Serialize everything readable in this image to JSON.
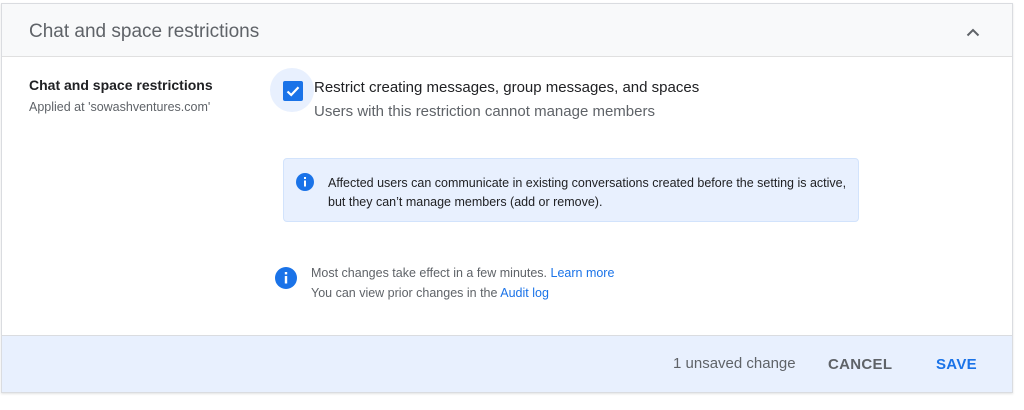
{
  "header": {
    "title": "Chat and space restrictions",
    "collapse_icon": "chevron-up-icon"
  },
  "setting": {
    "label": "Chat and space restrictions",
    "applied_at": "Applied at 'sowashventures.com'"
  },
  "option": {
    "checked": true,
    "label": "Restrict creating messages, group messages, and spaces",
    "description": "Users with this restriction cannot manage members"
  },
  "info_box": {
    "icon": "info-icon",
    "text": "Affected users can communicate in existing conversations created before the setting is active, but they can’t manage members (add or remove)."
  },
  "notes": {
    "icon": "info-icon",
    "line1_text": "Most changes take effect in a few minutes.",
    "line1_link": "Learn more",
    "line2_text": "You can view prior changes in the",
    "line2_link": "Audit log"
  },
  "footer": {
    "status": "1 unsaved change",
    "cancel_label": "CANCEL",
    "save_label": "SAVE"
  },
  "colors": {
    "accent": "#1a73e8",
    "info_bg": "#e8f0fe",
    "header_bg": "#f8f9fa"
  }
}
